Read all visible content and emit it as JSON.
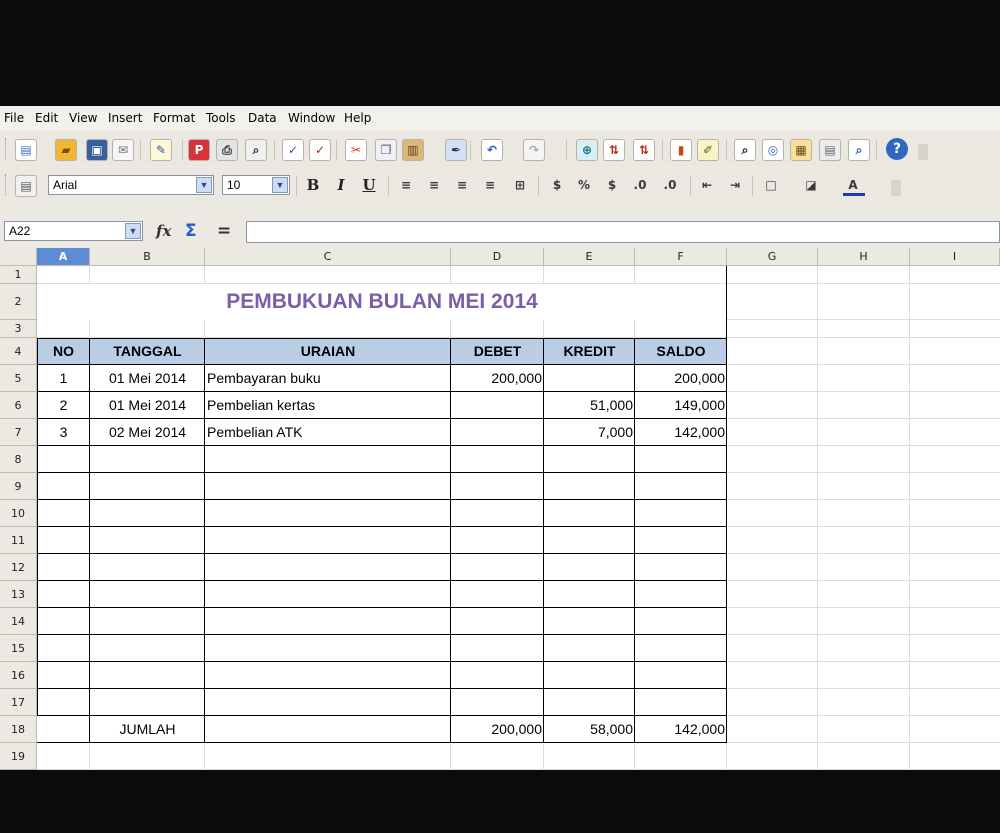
{
  "menu": [
    "File",
    "Edit",
    "View",
    "Insert",
    "Format",
    "Tools",
    "Data",
    "Window",
    "Help"
  ],
  "toolbar": {
    "font_name": "Arial",
    "font_size": "10",
    "bold": "B",
    "italic": "I",
    "underline": "U",
    "percent": "%",
    "help": "?"
  },
  "formula_bar": {
    "cell_ref": "A22",
    "function_wizard": "fx",
    "sum": "Σ",
    "equals": "=",
    "content": ""
  },
  "columns": [
    "A",
    "B",
    "C",
    "D",
    "E",
    "F",
    "G",
    "H",
    "I"
  ],
  "rows": [
    "1",
    "2",
    "3",
    "4",
    "5",
    "6",
    "7",
    "8",
    "9",
    "10",
    "11",
    "12",
    "13",
    "14",
    "15",
    "16",
    "17",
    "18",
    "19"
  ],
  "sheet": {
    "title": "PEMBUKUAN BULAN  MEI 2014",
    "headers": [
      "NO",
      "TANGGAL",
      "URAIAN",
      "DEBET",
      "KREDIT",
      "SALDO"
    ],
    "entries": [
      {
        "no": "1",
        "tanggal": "01 Mei 2014",
        "uraian": "Pembayaran buku",
        "debet": "200,000",
        "kredit": "",
        "saldo": "200,000"
      },
      {
        "no": "2",
        "tanggal": "01 Mei 2014",
        "uraian": "Pembelian kertas",
        "debet": "",
        "kredit": "51,000",
        "saldo": "149,000"
      },
      {
        "no": "3",
        "tanggal": "02 Mei 2014",
        "uraian": "Pembelian ATK",
        "debet": "",
        "kredit": "7,000",
        "saldo": "142,000"
      }
    ],
    "total": {
      "label": "JUMLAH",
      "debet": "200,000",
      "kredit": "58,000",
      "saldo": "142,000"
    }
  },
  "colors": {
    "title": "#7b5ea7",
    "header_fill": "#b9cde5",
    "selected_column": "#5e8bd6"
  }
}
